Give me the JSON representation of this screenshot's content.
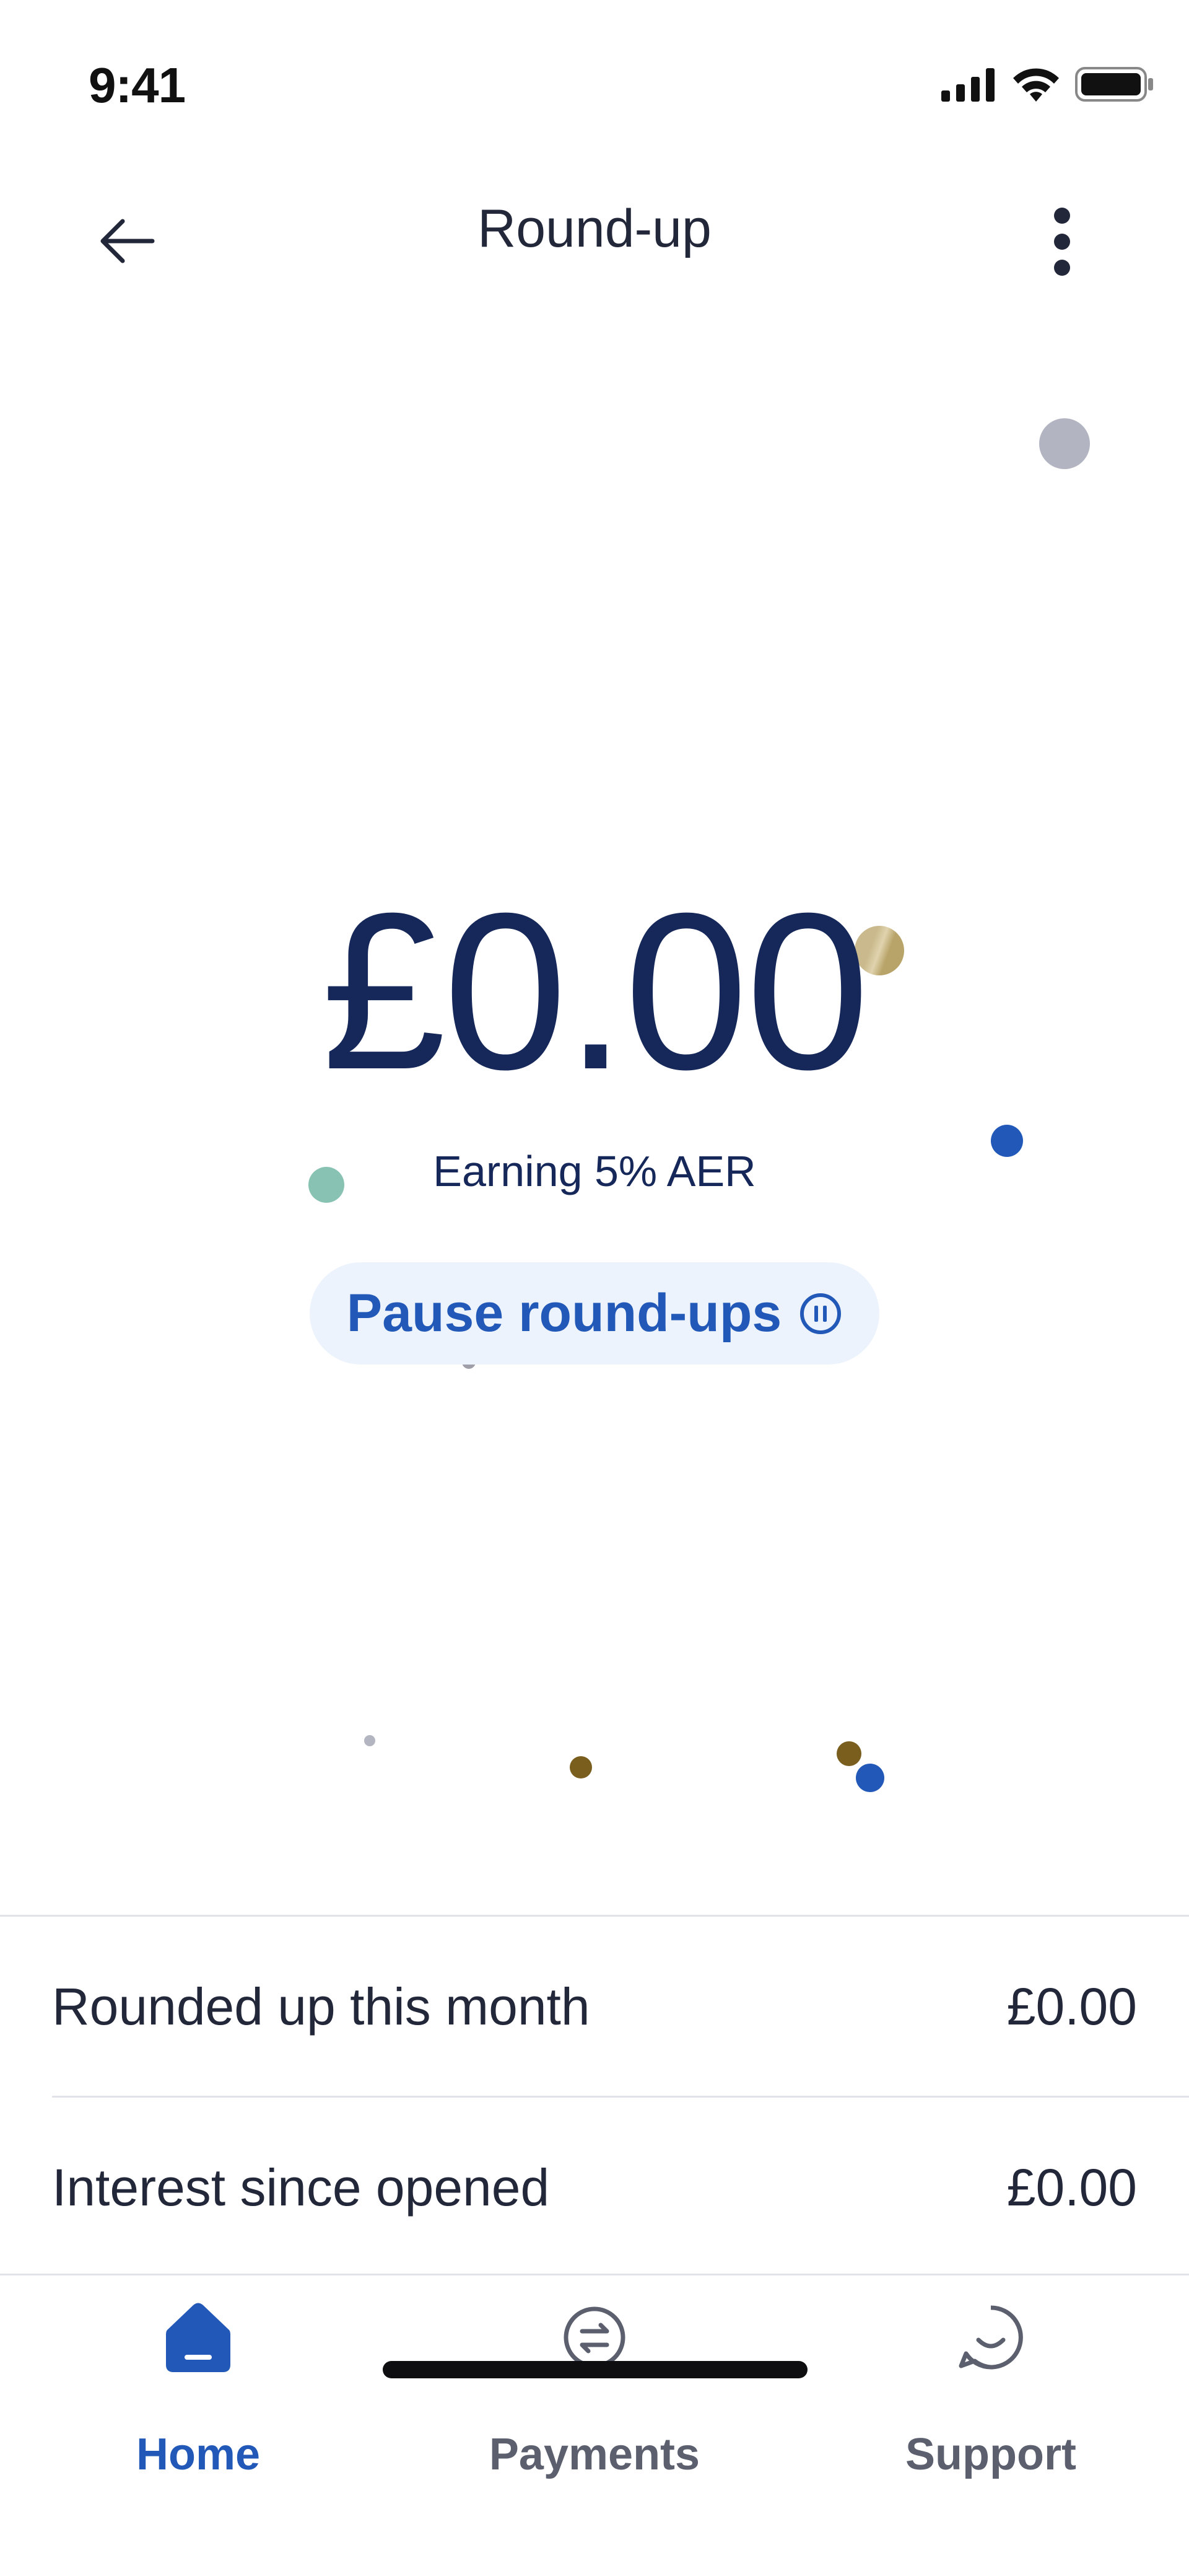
{
  "status_bar": {
    "time": "9:41"
  },
  "header": {
    "title": "Round-up"
  },
  "hero": {
    "balance": "£0.00",
    "rate_text": "Earning 5% AER",
    "pause_label": "Pause round-ups"
  },
  "stats": [
    {
      "label": "Rounded up this month",
      "value": "£0.00"
    },
    {
      "label": "Interest since opened",
      "value": "£0.00"
    }
  ],
  "tabs": [
    {
      "label": "Home",
      "icon": "home-icon",
      "active": true
    },
    {
      "label": "Payments",
      "icon": "payments-icon",
      "active": false
    },
    {
      "label": "Support",
      "icon": "support-icon",
      "active": false
    }
  ],
  "colors": {
    "accent": "#2259b8",
    "balance_text": "#16285a",
    "pause_bg": "#ecf3fc",
    "tab_inactive": "#5b5f6e"
  }
}
